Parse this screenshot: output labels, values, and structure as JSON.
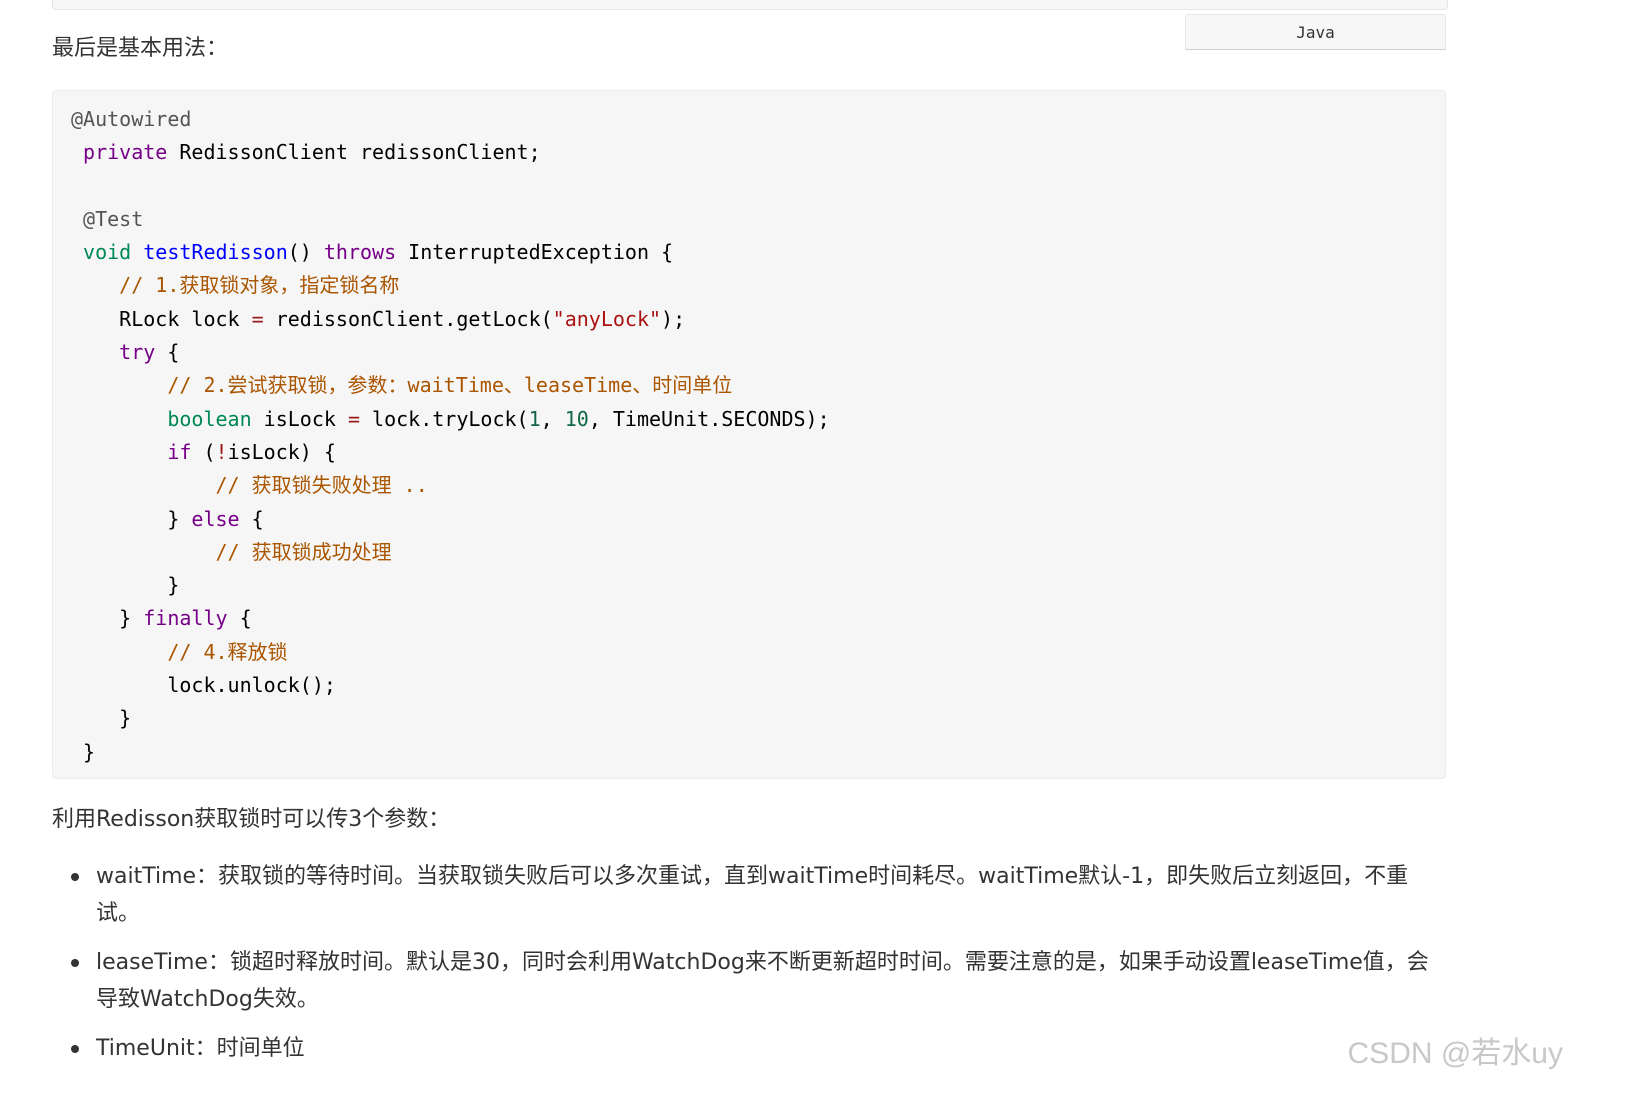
{
  "intro_text": "最后是基本用法：",
  "code_lang": "Java",
  "code_lines": [
    [
      {
        "t": "@Autowired",
        "c": "ann"
      }
    ],
    [
      {
        "t": " "
      },
      {
        "t": "private",
        "c": "kw"
      },
      {
        "t": " RedissonClient redissonClient;"
      }
    ],
    [],
    [
      {
        "t": " "
      },
      {
        "t": "@Test",
        "c": "ann"
      }
    ],
    [
      {
        "t": " "
      },
      {
        "t": "void",
        "c": "ty"
      },
      {
        "t": " "
      },
      {
        "t": "testRedisson",
        "c": "fn"
      },
      {
        "t": "() "
      },
      {
        "t": "throws",
        "c": "kw"
      },
      {
        "t": " InterruptedException {"
      }
    ],
    [
      {
        "t": "    "
      },
      {
        "t": "// 1.获取锁对象，指定锁名称",
        "c": "cm"
      }
    ],
    [
      {
        "t": "    RLock lock "
      },
      {
        "t": "=",
        "c": "op"
      },
      {
        "t": " redissonClient.getLock("
      },
      {
        "t": "\"anyLock\"",
        "c": "str"
      },
      {
        "t": ");"
      }
    ],
    [
      {
        "t": "    "
      },
      {
        "t": "try",
        "c": "kw"
      },
      {
        "t": " {"
      }
    ],
    [
      {
        "t": "        "
      },
      {
        "t": "// 2.尝试获取锁，参数：waitTime、leaseTime、时间单位",
        "c": "cm"
      }
    ],
    [
      {
        "t": "        "
      },
      {
        "t": "boolean",
        "c": "ty"
      },
      {
        "t": " isLock "
      },
      {
        "t": "=",
        "c": "op"
      },
      {
        "t": " lock.tryLock("
      },
      {
        "t": "1",
        "c": "num"
      },
      {
        "t": ", "
      },
      {
        "t": "10",
        "c": "num"
      },
      {
        "t": ", TimeUnit.SECONDS);"
      }
    ],
    [
      {
        "t": "        "
      },
      {
        "t": "if",
        "c": "kw"
      },
      {
        "t": " ("
      },
      {
        "t": "!",
        "c": "op"
      },
      {
        "t": "isLock) {"
      }
    ],
    [
      {
        "t": "            "
      },
      {
        "t": "// 获取锁失败处理 ..",
        "c": "cm"
      }
    ],
    [
      {
        "t": "        } "
      },
      {
        "t": "else",
        "c": "kw"
      },
      {
        "t": " {"
      }
    ],
    [
      {
        "t": "            "
      },
      {
        "t": "// 获取锁成功处理",
        "c": "cm"
      }
    ],
    [
      {
        "t": "        }"
      }
    ],
    [
      {
        "t": "    } "
      },
      {
        "t": "finally",
        "c": "kw"
      },
      {
        "t": " {"
      }
    ],
    [
      {
        "t": "        "
      },
      {
        "t": "// 4.释放锁",
        "c": "cm"
      }
    ],
    [
      {
        "t": "        lock.unlock();"
      }
    ],
    [
      {
        "t": "    }"
      }
    ],
    [
      {
        "t": " }"
      }
    ]
  ],
  "params_intro": "利用Redisson获取锁时可以传3个参数：",
  "bullets": [
    "waitTime：获取锁的等待时间。当获取锁失败后可以多次重试，直到waitTime时间耗尽。waitTime默认-1，即失败后立刻返回，不重试。",
    "leaseTime：锁超时释放时间。默认是30，同时会利用WatchDog来不断更新超时时间。需要注意的是，如果手动设置leaseTime值，会导致WatchDog失效。",
    "TimeUnit：时间单位"
  ],
  "watermark": "CSDN @若水uy"
}
